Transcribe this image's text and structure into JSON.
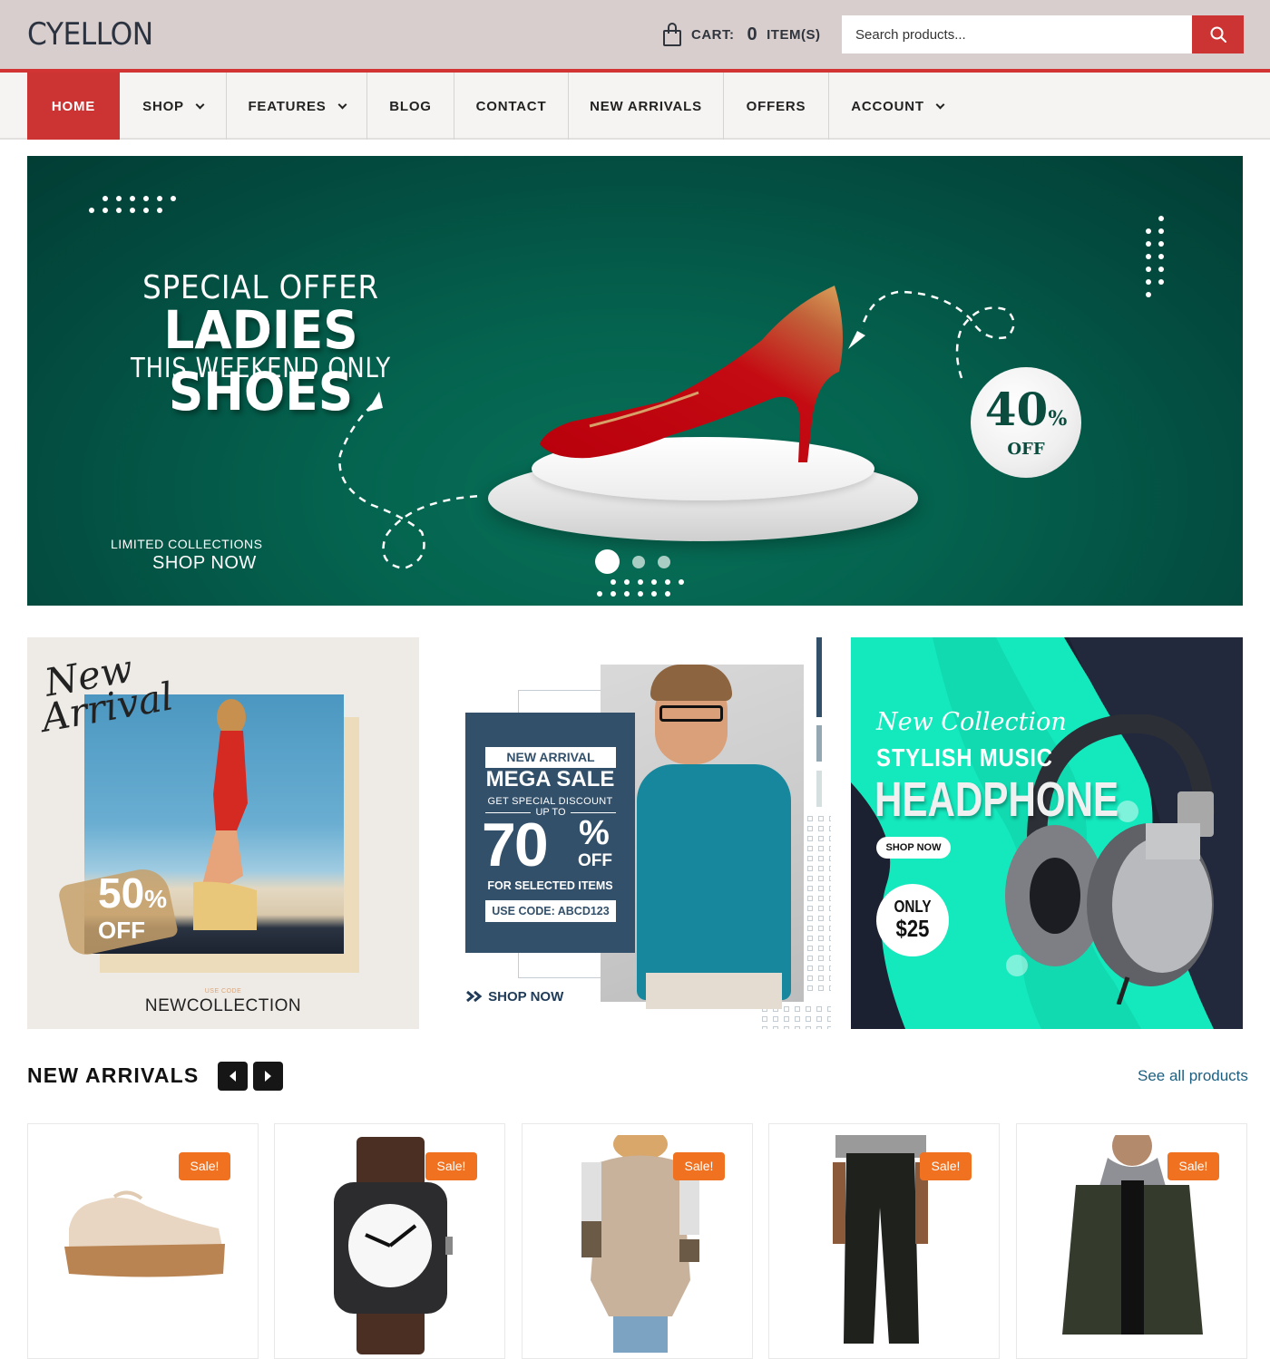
{
  "header": {
    "logo": "CYELLON",
    "cart_label": "CART:",
    "cart_count": "0",
    "cart_items_label": "ITEM(S)",
    "search_placeholder": "Search products...",
    "icons": {
      "cart": "shopping-bag-icon",
      "search": "search-icon"
    }
  },
  "colors": {
    "accent": "#cc3333",
    "topbar_bg": "#d8cecd",
    "nav_bg": "#f5f4f2",
    "hero_green": "#04634e",
    "sale_badge": "#f07120",
    "link": "#1e5f80",
    "promo_panel": "#33506a",
    "headphone_green": "#14e8bd"
  },
  "nav": {
    "items": [
      {
        "label": "HOME",
        "active": true,
        "dropdown": false
      },
      {
        "label": "SHOP",
        "active": false,
        "dropdown": true
      },
      {
        "label": "FEATURES",
        "active": false,
        "dropdown": true
      },
      {
        "label": "BLOG",
        "active": false,
        "dropdown": false
      },
      {
        "label": "CONTACT",
        "active": false,
        "dropdown": false
      },
      {
        "label": "NEW ARRIVALS",
        "active": false,
        "dropdown": false
      },
      {
        "label": "OFFERS",
        "active": false,
        "dropdown": false
      },
      {
        "label": "ACCOUNT",
        "active": false,
        "dropdown": true
      }
    ]
  },
  "hero": {
    "line1": "SPECIAL OFFER",
    "line2": "LADIES SHOES",
    "line3": "THIS WEEKEND ONLY",
    "limited": "LIMITED COLLECTIONS",
    "shop_now": "SHOP NOW",
    "discount_value": "40",
    "discount_symbol": "%",
    "discount_off": "OFF",
    "slides_total": 3,
    "active_slide": 1
  },
  "promos": [
    {
      "script1": "New",
      "script2": "Arrival",
      "discount": "50",
      "symbol": "%",
      "off": "OFF",
      "use_code_label": "USE CODE",
      "code": "NEWCOLLECTION"
    },
    {
      "tag": "NEW ARRIVAL",
      "headline": "MEGA SALE",
      "sub": "GET SPECIAL DISCOUNT",
      "upto": "UP TO",
      "discount": "70",
      "symbol": "%",
      "off": "OFF",
      "selected": "FOR SELECTED ITEMS",
      "code": "USE CODE: ABCD123",
      "shop_now": "SHOP NOW",
      "shop_icon": "double-chevron-right-icon"
    },
    {
      "script": "New Collection",
      "line1": "STYLISH MUSIC",
      "line2": "HEADPHONE",
      "shop_now": "SHOP NOW",
      "only": "ONLY",
      "price": "$25"
    }
  ],
  "new_arrivals": {
    "title": "NEW ARRIVALS",
    "prev_icon": "caret-left-icon",
    "next_icon": "caret-right-icon",
    "see_all": "See all products",
    "products": [
      {
        "image": "beige-lace-platform-shoe",
        "badge": "Sale!"
      },
      {
        "image": "timex-expedition-watch",
        "badge": "Sale!"
      },
      {
        "image": "beige-leopard-sleeve-top",
        "badge": "Sale!"
      },
      {
        "image": "black-mens-jeans",
        "badge": "Sale!"
      },
      {
        "image": "olive-hooded-jacket",
        "badge": "Sale!"
      }
    ]
  }
}
